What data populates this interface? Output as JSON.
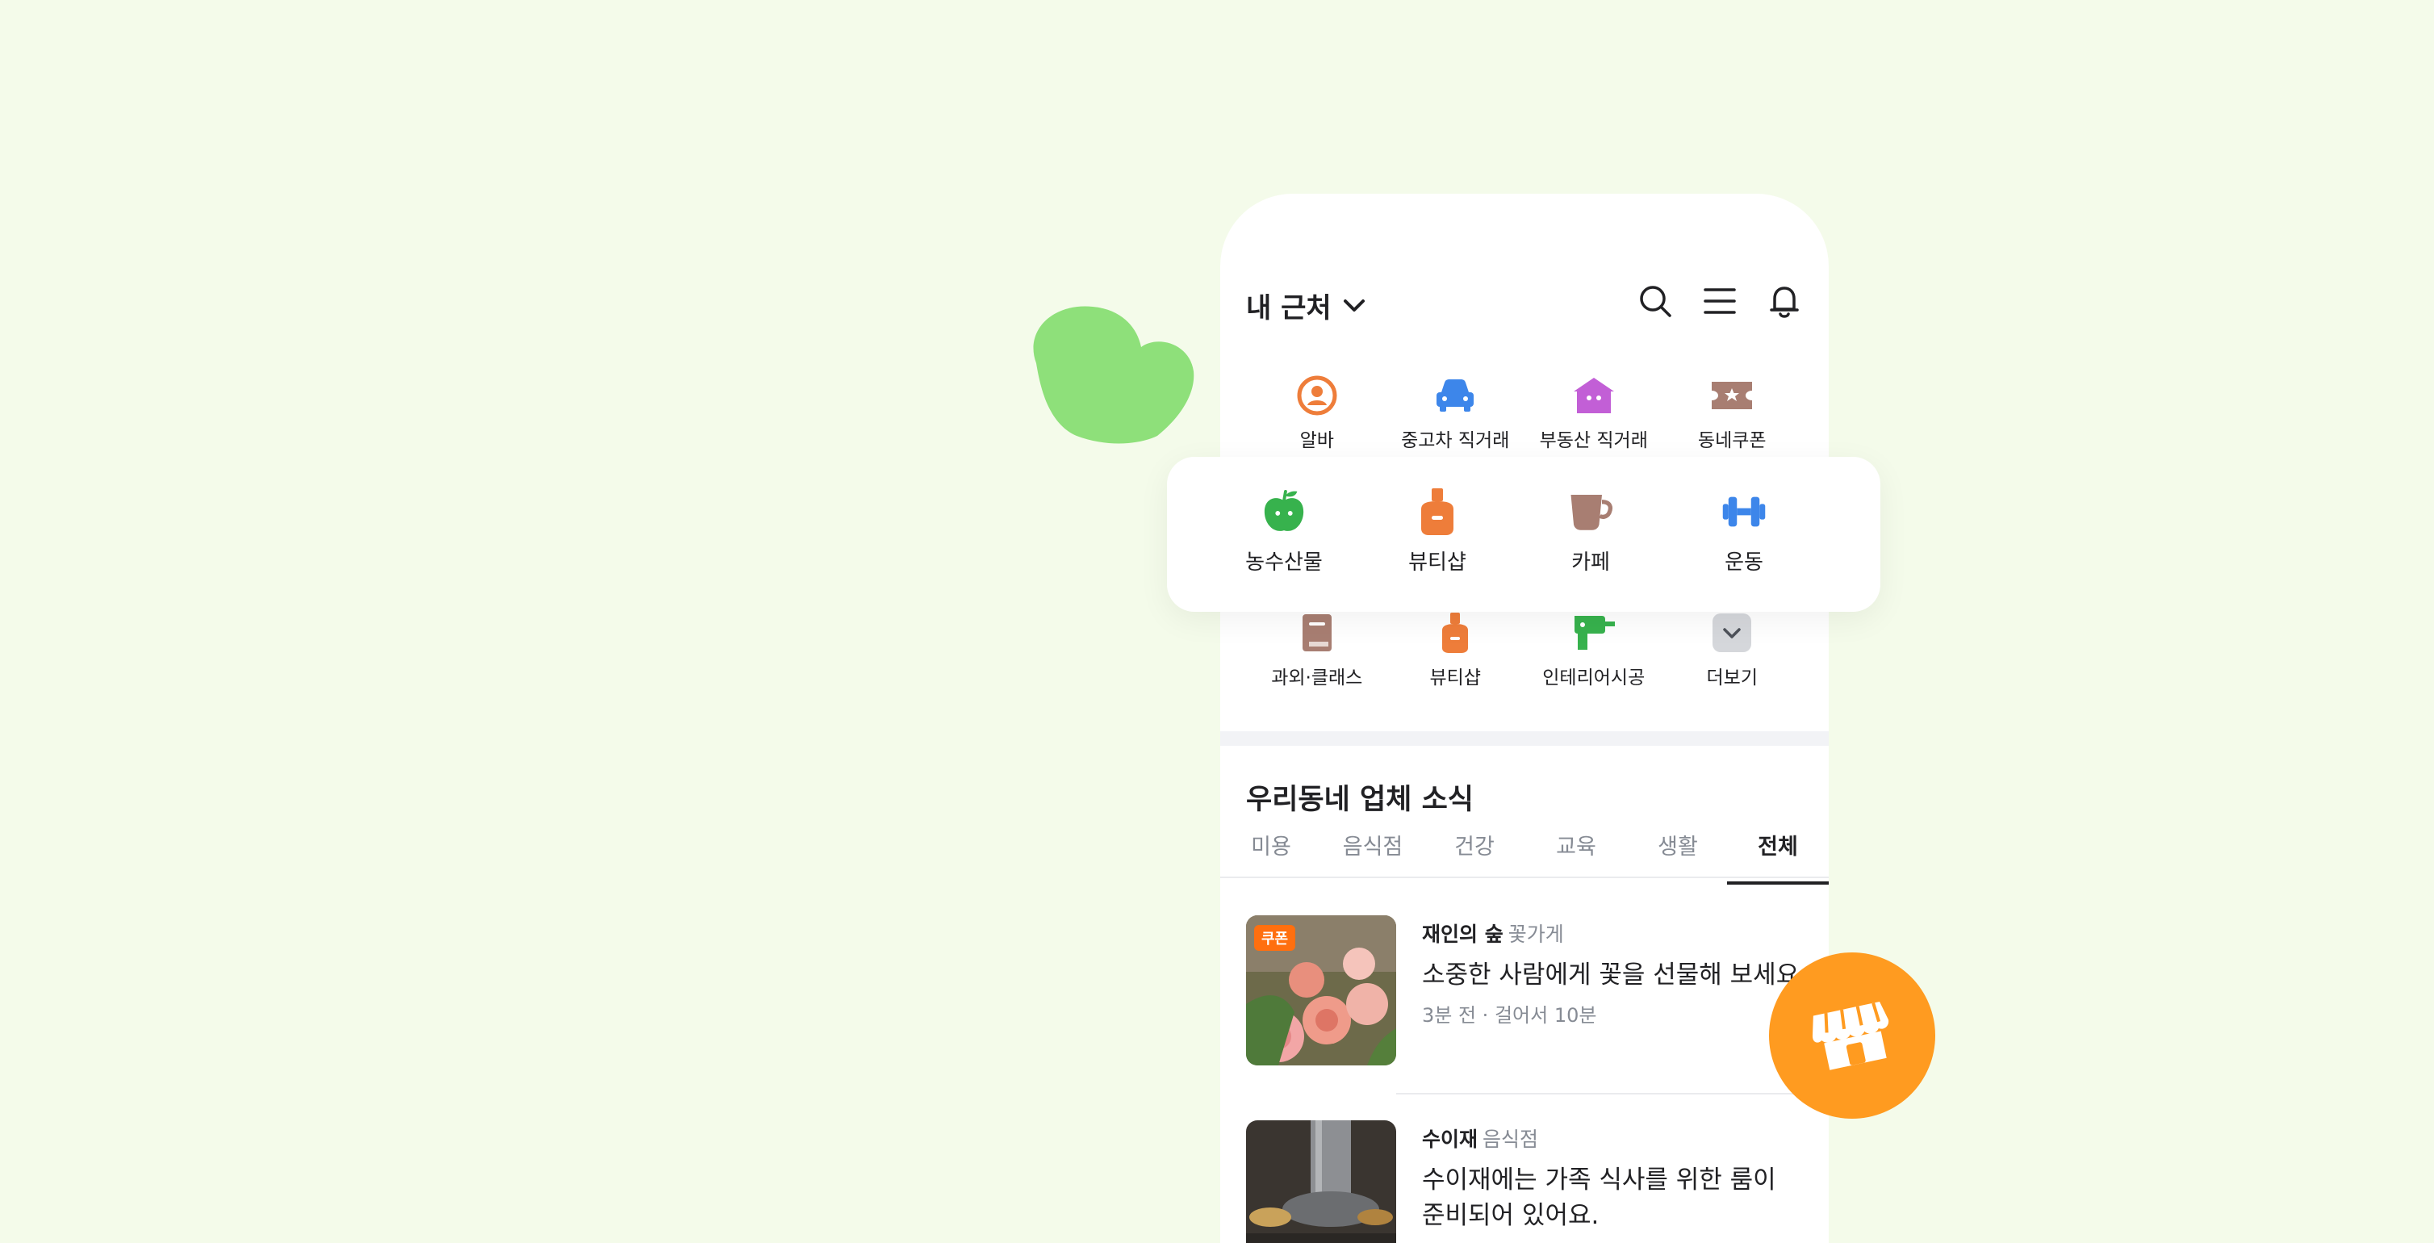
{
  "header": {
    "location_label": "내 근처"
  },
  "categories_top": [
    {
      "label": "알바",
      "icon": "part-time-job-icon"
    },
    {
      "label": "중고차 직거래",
      "icon": "car-icon"
    },
    {
      "label": "부동산 직거래",
      "icon": "house-icon"
    },
    {
      "label": "동네쿠폰",
      "icon": "coupon-ticket-icon"
    }
  ],
  "categories_bottom": [
    {
      "label": "과외·클래스",
      "icon": "book-icon"
    },
    {
      "label": "뷰티샵",
      "icon": "beauty-bottle-icon"
    },
    {
      "label": "인테리어시공",
      "icon": "drill-icon"
    },
    {
      "label": "더보기",
      "icon": "chevron-down-icon"
    }
  ],
  "featured_card": [
    {
      "label": "농수산물",
      "icon": "apple-icon"
    },
    {
      "label": "뷰티샵",
      "icon": "beauty-bottle-icon"
    },
    {
      "label": "카페",
      "icon": "coffee-cup-icon"
    },
    {
      "label": "운동",
      "icon": "dumbbell-icon"
    }
  ],
  "news_section": {
    "title": "우리동네 업체 소식",
    "tabs": [
      "미용",
      "음식점",
      "건강",
      "교육",
      "생활",
      "전체"
    ],
    "active_tab": "전체"
  },
  "feed": [
    {
      "badge": "쿠폰",
      "name": "재인의 숲",
      "category": "꽃가게",
      "description": "소중한 사람에게 꽃을 선물해 보세요.",
      "meta": "3분 전 · 걸어서 10분"
    },
    {
      "name": "수이재",
      "category": "음식점",
      "description": "수이재에는 가족 식사를 위한 룸이",
      "description_line2": "준비되어 있어요."
    }
  ],
  "colors": {
    "background": "#f4fbea",
    "accent_green": "#8ee07a",
    "accent_orange": "#ff9b20",
    "icon_orange": "#ee7d3a",
    "icon_blue": "#3d86ea",
    "icon_purple": "#c25fd6",
    "icon_brown": "#a87e72",
    "icon_green": "#37b24d"
  }
}
